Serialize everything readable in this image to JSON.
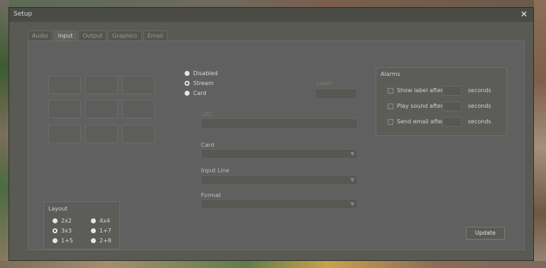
{
  "window": {
    "title": "Setup",
    "close_glyph": "✕"
  },
  "tabs": [
    {
      "label": "Audio"
    },
    {
      "label": "Input",
      "active": true
    },
    {
      "label": "Output"
    },
    {
      "label": "Graphics"
    },
    {
      "label": "Email"
    }
  ],
  "source": {
    "options": [
      {
        "label": "Disabled",
        "selected": false
      },
      {
        "label": "Stream",
        "selected": true
      },
      {
        "label": "Card",
        "selected": false
      }
    ],
    "label_field": {
      "label": "Label",
      "value": ""
    },
    "url_field": {
      "label": "URL",
      "value": ""
    }
  },
  "card": {
    "label": "Card",
    "value": ""
  },
  "input_line": {
    "label": "Input Line",
    "value": ""
  },
  "format": {
    "label": "Format",
    "value": ""
  },
  "layout": {
    "title": "Layout",
    "options": [
      {
        "label": "2x2",
        "selected": false
      },
      {
        "label": "4x4",
        "selected": false
      },
      {
        "label": "3x3",
        "selected": true
      },
      {
        "label": "1+7",
        "selected": false
      },
      {
        "label": "1+5",
        "selected": false
      },
      {
        "label": "2+8",
        "selected": false
      }
    ]
  },
  "alarms": {
    "title": "Alarms",
    "rows": [
      {
        "label": "Show label after",
        "unit": "seconds"
      },
      {
        "label": "Play sound after",
        "unit": "seconds"
      },
      {
        "label": "Send email after",
        "unit": "seconds"
      }
    ]
  },
  "update_button": "Update",
  "colors": {
    "dialog_bg": "#5a5a55",
    "panel_bg": "#606060",
    "text": "#cfcfcf"
  }
}
